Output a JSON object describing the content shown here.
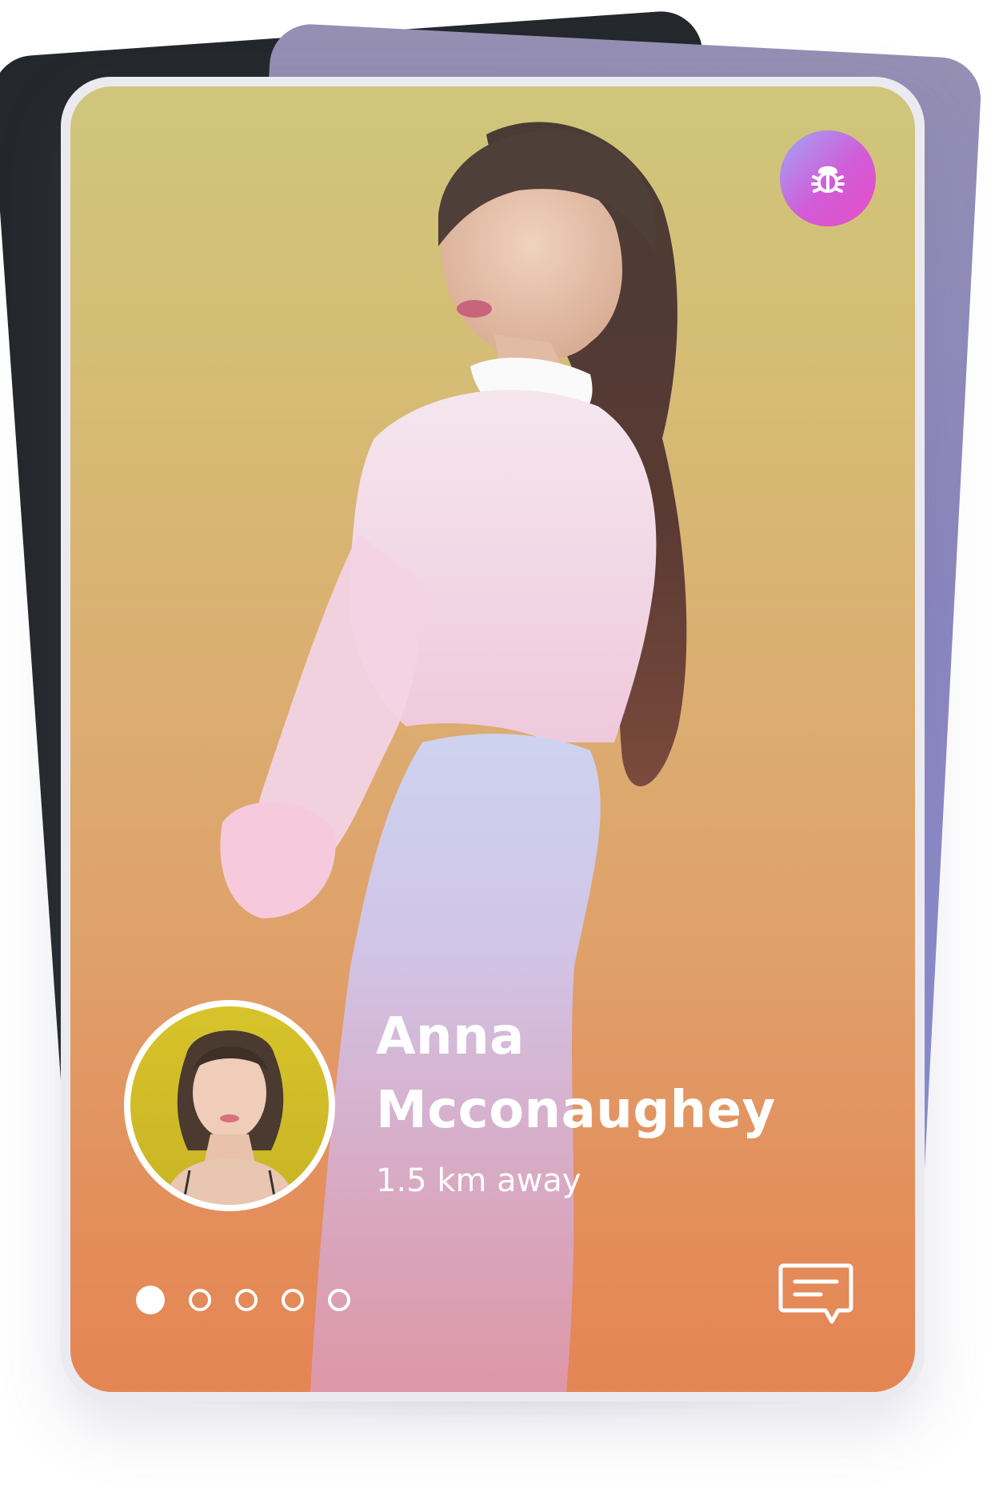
{
  "profile": {
    "name_line1": "Anna",
    "name_line2": "Mcconaughey",
    "distance": "1.5 km away"
  },
  "badge": {
    "icon": "bug-icon",
    "gradient": [
      "#9fa6f5",
      "#d35bd8",
      "#e54fc4"
    ]
  },
  "carousel": {
    "total": 5,
    "active_index": 0
  },
  "actions": {
    "chat_icon": "chat-bubble-icon"
  },
  "colors": {
    "back_card_dark": "#24272b",
    "back_card_purple": "#8d8bc4",
    "photo_top": "#cfc67c",
    "photo_bottom": "#e58a57",
    "text": "#ffffff"
  }
}
